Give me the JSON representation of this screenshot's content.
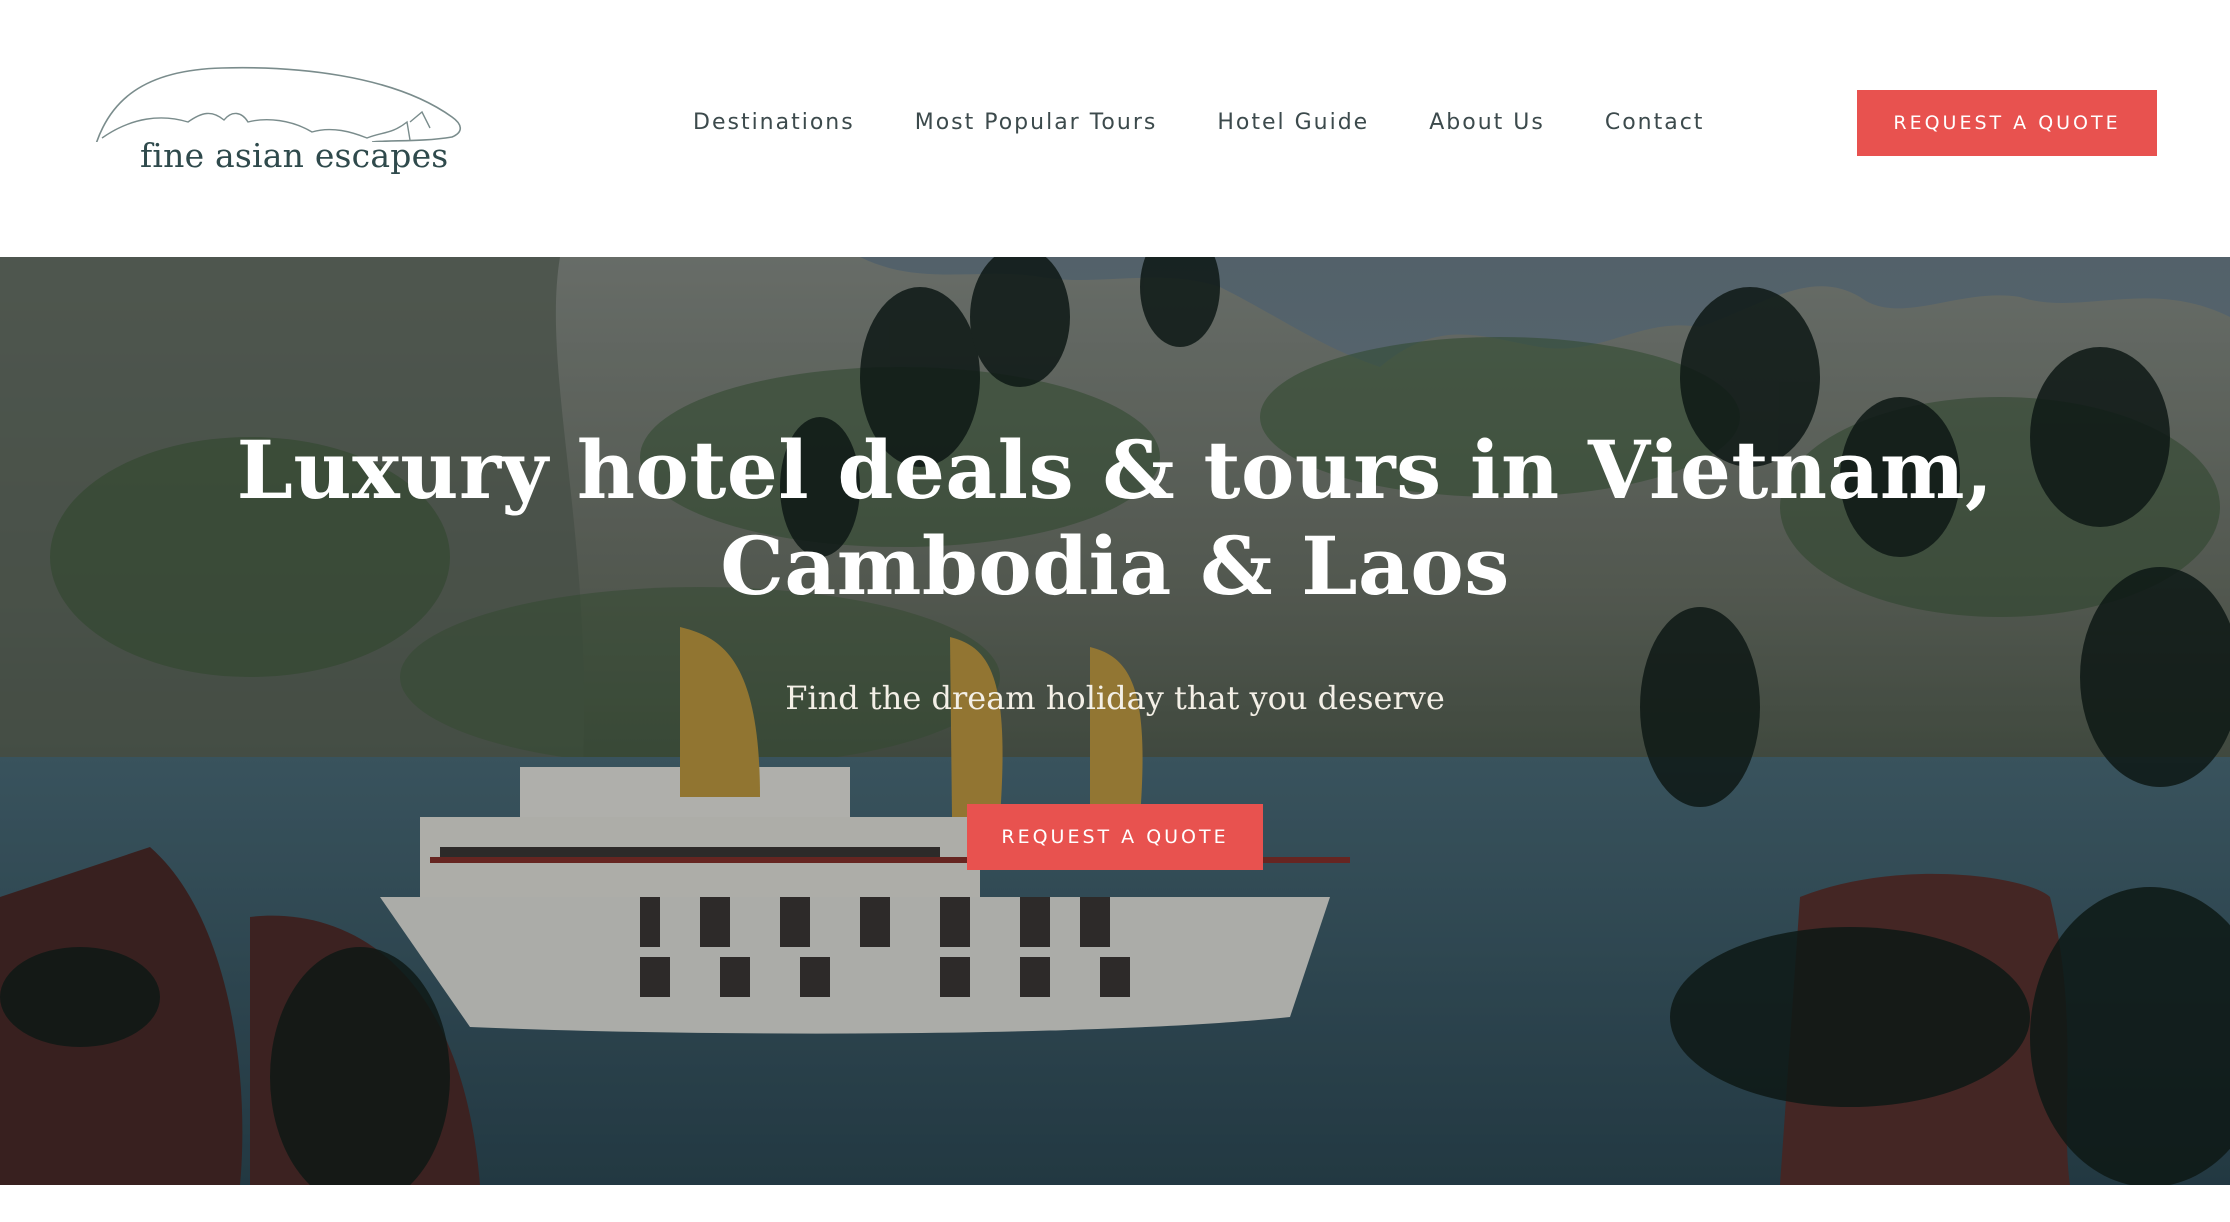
{
  "brand": {
    "name": "fine asian escapes",
    "accent_color": "#e8524f",
    "text_color": "#2f4a4c"
  },
  "nav": {
    "items": [
      {
        "label": "Destinations"
      },
      {
        "label": "Most Popular Tours"
      },
      {
        "label": "Hotel Guide"
      },
      {
        "label": "About Us"
      },
      {
        "label": "Contact"
      }
    ],
    "cta_label": "REQUEST A QUOTE"
  },
  "hero": {
    "title_line1": "Luxury hotel deals & tours in Vietnam,",
    "title_line2": "Cambodia & Laos",
    "subtitle": "Find the dream holiday that you deserve",
    "cta_label": "REQUEST A QUOTE",
    "image_icon": "halong-bay-cruise-photo"
  }
}
